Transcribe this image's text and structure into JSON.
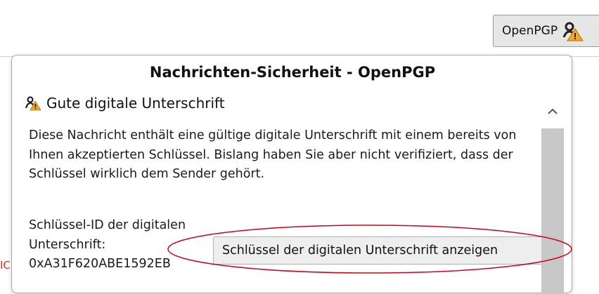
{
  "toolbar": {
    "openpgp_label": "OpenPGP",
    "openpgp_icon": "signature-warning-icon"
  },
  "background": {
    "left_edge_text": "IC"
  },
  "popup": {
    "title": "Nachrichten-Sicherheit - OpenPGP",
    "status_label": "Gute digitale Unterschrift",
    "status_icon": "signature-warning-icon",
    "description": "Diese Nachricht enthält eine gültige digitale Unterschrift mit einem bereits von Ihnen akzeptierten Schlüssel. Bislang haben Sie aber nicht verifiziert, dass der Schlüssel wirklich dem Sender gehört.",
    "key_id_label": "Schlüssel-ID der digitalen Unterschrift:",
    "key_id_value": "0xA31F620ABE1592EB",
    "show_key_button": "Schlüssel der digitalen Unterschrift anzeigen"
  },
  "colors": {
    "annotation": "#d0021b",
    "warning": "#f5a623"
  }
}
